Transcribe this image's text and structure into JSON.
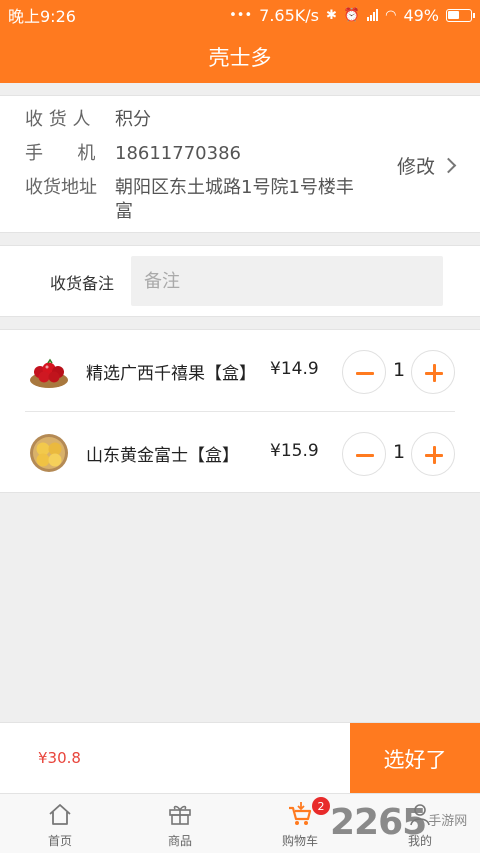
{
  "status_bar": {
    "time": "晚上9:26",
    "dots": "•••",
    "network_speed": "7.65K/s",
    "battery": "49%"
  },
  "header": {
    "title": "壳士多"
  },
  "address": {
    "receiver_label": "收 货 人",
    "receiver_value": "积分",
    "phone_label": "手      机",
    "phone_value": "18611770386",
    "address_label": "收货地址",
    "address_value": "朝阳区东土城路1号院1号楼丰富",
    "edit_label": "修改"
  },
  "remark": {
    "label": "收货备注",
    "placeholder": "备注",
    "value": ""
  },
  "cart": {
    "items": [
      {
        "name": "精选广西千禧果【盒】",
        "price": "¥14.9",
        "quantity": "1",
        "image": "cherry-tomato-bowl"
      },
      {
        "name": "山东黄金富士【盒】",
        "price": "¥15.9",
        "quantity": "1",
        "image": "apple-basket"
      }
    ]
  },
  "checkout": {
    "total": "¥30.8",
    "confirm_label": "选好了"
  },
  "tabs": [
    {
      "label": "首页",
      "icon": "home-icon"
    },
    {
      "label": "商品",
      "icon": "gift-icon"
    },
    {
      "label": "购物车",
      "icon": "cart-icon",
      "badge": "2",
      "active": true
    },
    {
      "label": "我的",
      "icon": "user-icon"
    }
  ],
  "watermark": {
    "number": "2265",
    "text": "手游网"
  },
  "colors": {
    "accent": "#ff7a1f",
    "price_red": "#e8453c",
    "badge_red": "#e82b2b"
  }
}
